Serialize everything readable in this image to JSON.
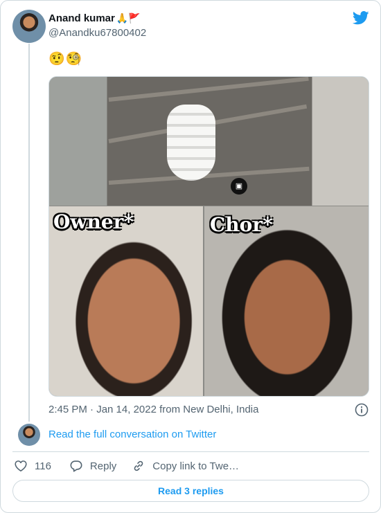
{
  "author": {
    "name": "Anand kumar",
    "name_emojis": "🙏🚩",
    "handle": "@Anandku67800402"
  },
  "tweet": {
    "text": "🤨🧐",
    "media_labels": {
      "left": "Owner*",
      "right": "Chor*"
    },
    "timestamp": "2:45 PM · Jan 14, 2022 from New Delhi, India"
  },
  "conversation": {
    "link_text": "Read the full conversation on Twitter"
  },
  "actions": {
    "like_count": "116",
    "reply_label": "Reply",
    "copy_label": "Copy link to Twe…"
  },
  "replies_button": "Read 3 replies",
  "colors": {
    "twitter_blue": "#1d9bf0",
    "secondary_text": "#536471",
    "border": "#cfd9de"
  },
  "icons": [
    "twitter-bird-icon",
    "info-icon",
    "heart-icon",
    "reply-icon",
    "link-icon",
    "instagram-icon"
  ]
}
